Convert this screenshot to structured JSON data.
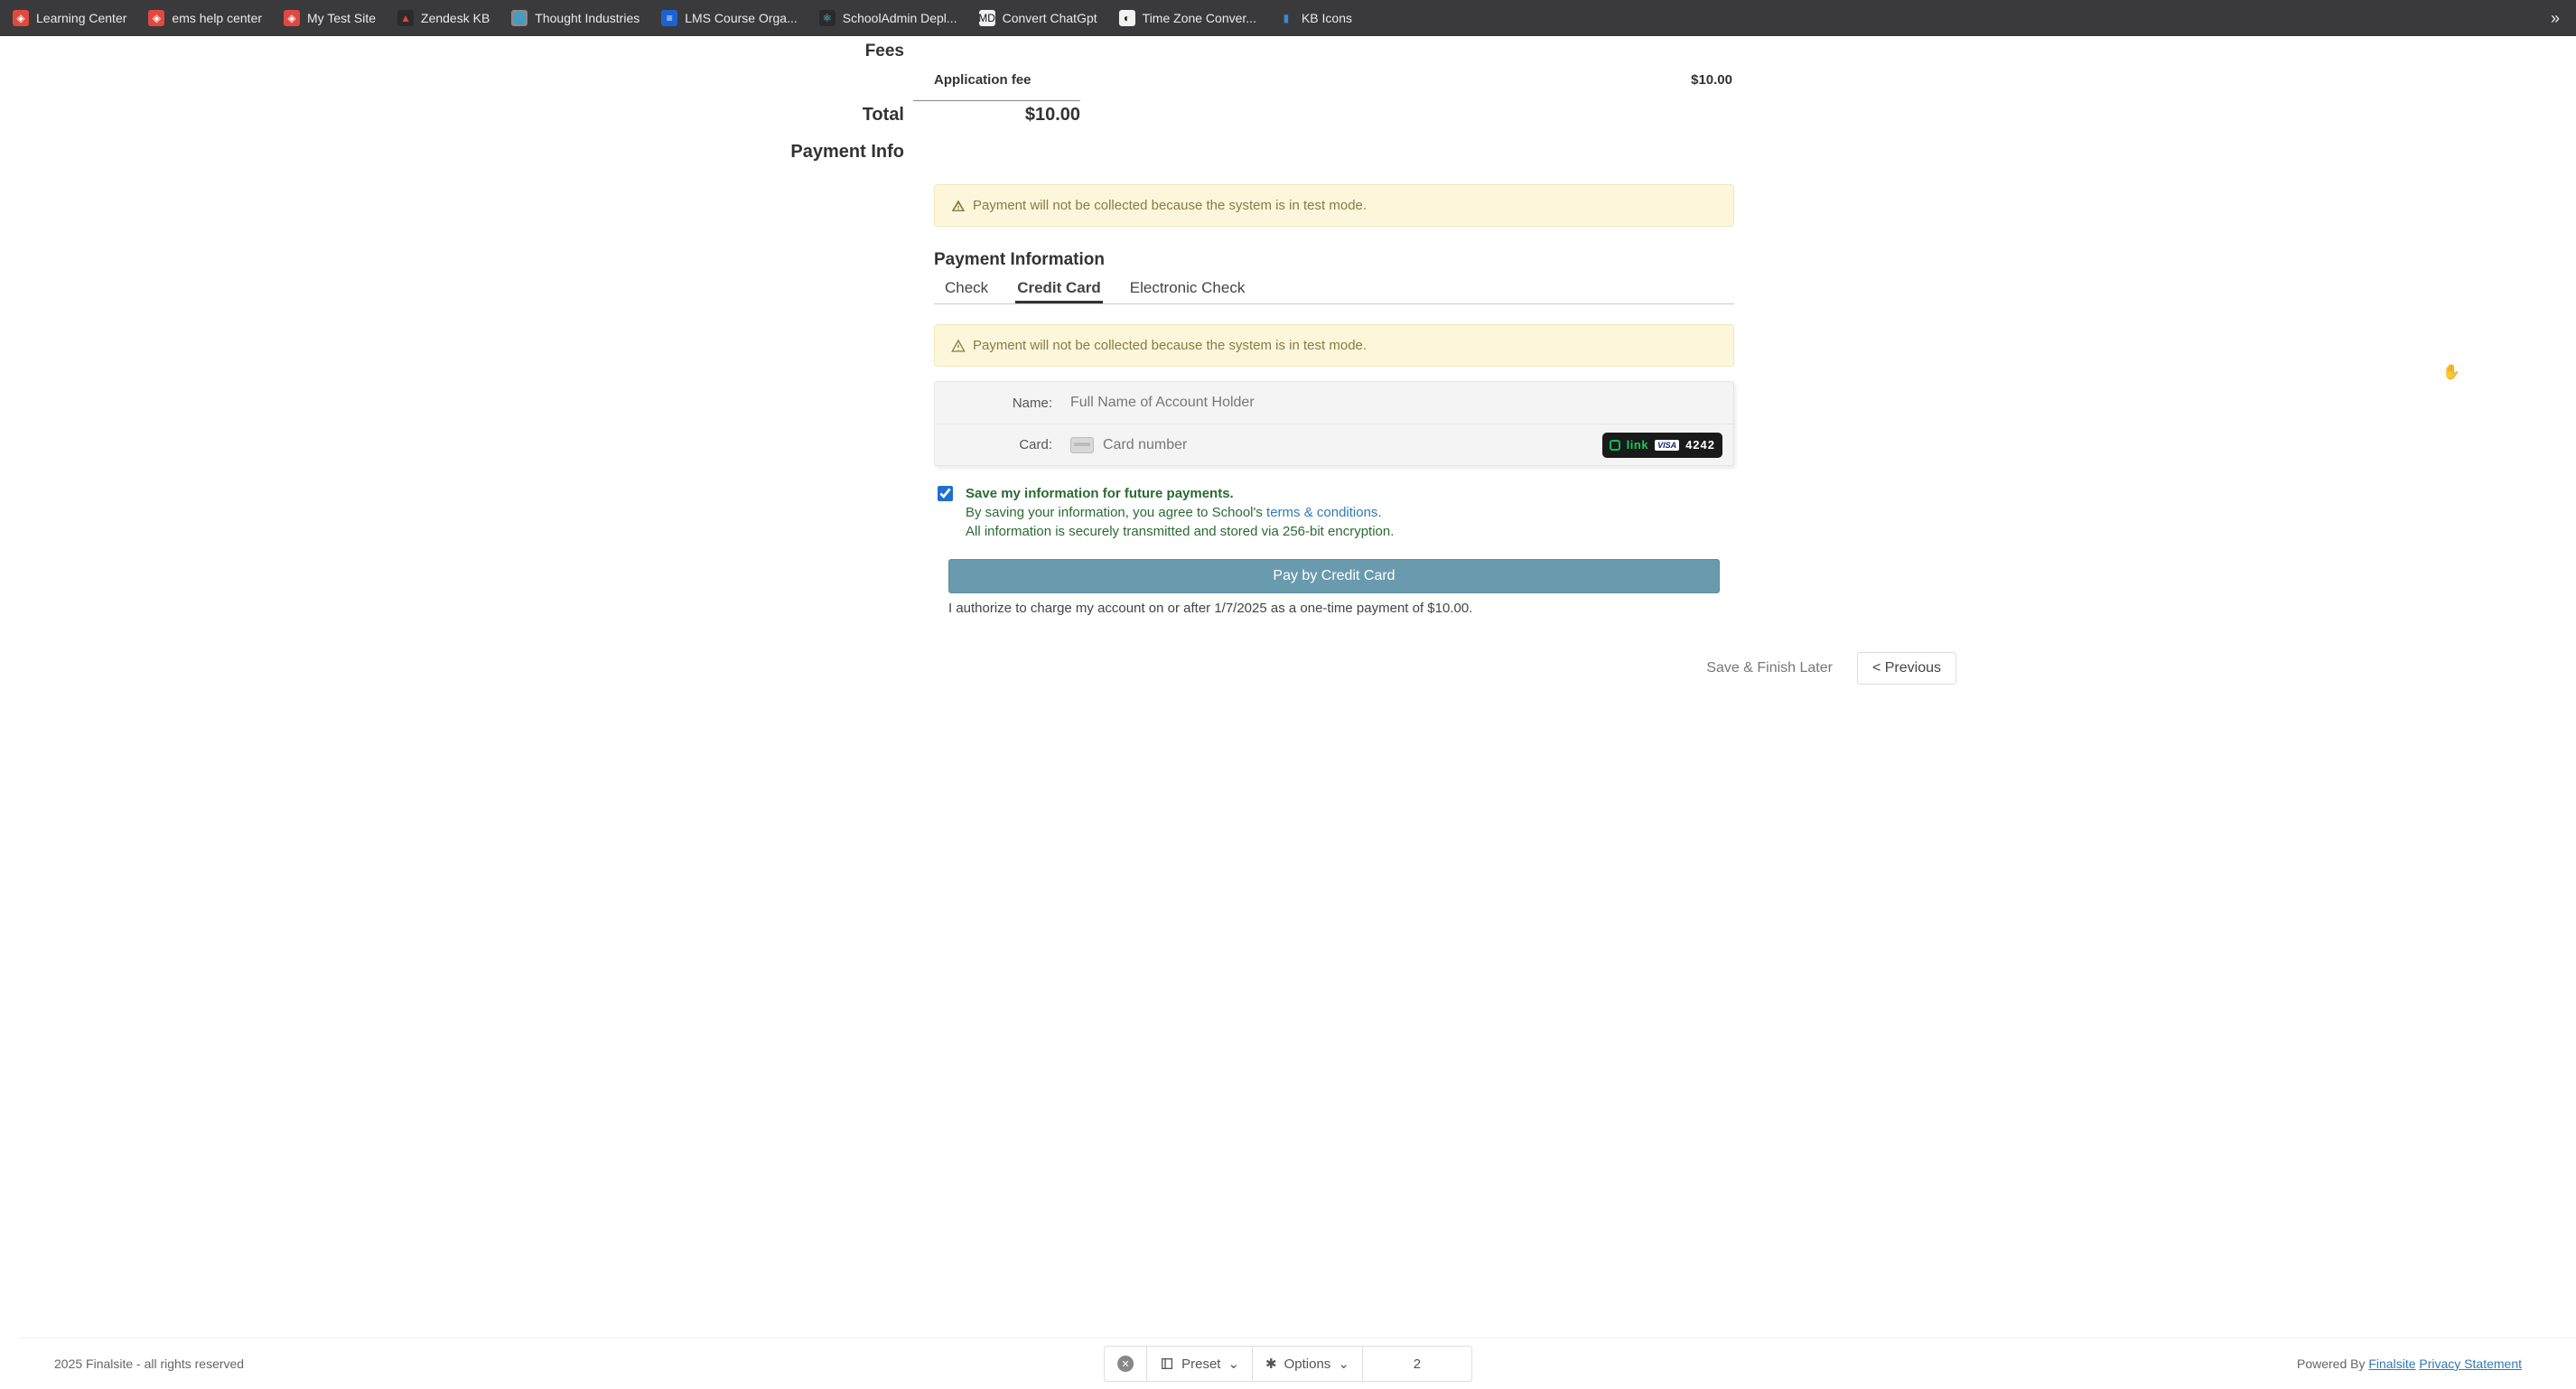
{
  "bookmarks": [
    {
      "label": "Learning Center",
      "icon_bg": "#e2483d",
      "icon_fg": "#fff",
      "glyph": "◈"
    },
    {
      "label": "ems help center",
      "icon_bg": "#e2483d",
      "icon_fg": "#fff",
      "glyph": "◈"
    },
    {
      "label": "My Test Site",
      "icon_bg": "#e2483d",
      "icon_fg": "#fff",
      "glyph": "◈"
    },
    {
      "label": "Zendesk KB",
      "icon_bg": "#2b2b2b",
      "icon_fg": "#e04632",
      "glyph": "▲"
    },
    {
      "label": "Thought Industries",
      "icon_bg": "#8a8a8a",
      "icon_fg": "#fff",
      "glyph": "🌐"
    },
    {
      "label": "LMS Course Orga...",
      "icon_bg": "#1b62d4",
      "icon_fg": "#fff",
      "glyph": "≡"
    },
    {
      "label": "SchoolAdmin Depl...",
      "icon_bg": "#2b2b2b",
      "icon_fg": "#5dd4ef",
      "glyph": "⚛"
    },
    {
      "label": "Convert ChatGpt",
      "icon_bg": "#f2f2f2",
      "icon_fg": "#111",
      "glyph": "MD"
    },
    {
      "label": "Time Zone Conver...",
      "icon_bg": "#f2f2f2",
      "icon_fg": "#111",
      "glyph": "◐"
    },
    {
      "label": "KB Icons",
      "icon_bg": "transparent",
      "icon_fg": "#3a8bd8",
      "glyph": "▮"
    }
  ],
  "overflow_glyph": "»",
  "sections": {
    "fees_label": "Fees",
    "total_label": "Total",
    "payment_info_label": "Payment Info"
  },
  "fee": {
    "name": "Application fee",
    "amount": "$10.00"
  },
  "total_amount": "$10.00",
  "alerts": {
    "test_mode": "Payment will not be collected because the system is in test mode."
  },
  "payment": {
    "heading": "Payment Information",
    "tabs": {
      "check": "Check",
      "credit": "Credit Card",
      "echeck": "Electronic Check"
    },
    "name_label": "Name:",
    "name_placeholder": "Full Name of Account Holder",
    "card_label": "Card:",
    "card_placeholder": "Card number",
    "autofill": {
      "brand": "link",
      "network": "VISA",
      "last4": "4242"
    },
    "save": {
      "title": "Save my information for future payments.",
      "line1_prefix": "By saving your information, you agree to School's ",
      "terms_link": "terms & conditions",
      "line1_suffix": ".",
      "line2": "All information is securely transmitted and stored via 256-bit encryption."
    },
    "pay_button": "Pay by Credit Card",
    "authorize": "I authorize to charge my account on or after 1/7/2025 as a one-time payment of $10.00."
  },
  "nav": {
    "save_later": "Save & Finish Later",
    "previous": "< Previous"
  },
  "footer": {
    "copyright": "2025 Finalsite - all rights reserved",
    "preset": "Preset",
    "options": "Options",
    "page_number": "2",
    "powered_prefix": "Powered By ",
    "brand": "Finalsite",
    "privacy": "Privacy Statement"
  }
}
